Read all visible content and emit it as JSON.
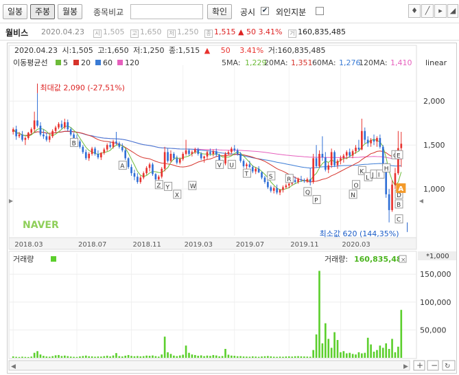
{
  "toolbar": {
    "periods": [
      "일봉",
      "주봉",
      "월봉"
    ],
    "active_period": "주봉",
    "compare_label": "종목비교",
    "compare_value": "",
    "confirm_label": "확인",
    "disclosure_label": "공시",
    "disclosure_checked": true,
    "foreign_label": "외인지분",
    "foreign_checked": false
  },
  "info": {
    "name": "월비스",
    "date": "2020.04.23",
    "open": "1,505",
    "high": "1,650",
    "low": "1,250",
    "close": "1,515",
    "change": "▲ 50",
    "pct": "3.41%",
    "volume": "160,835,485",
    "open_icon": "시",
    "high_icon": "고",
    "low_icon": "저",
    "close_icon": "종",
    "volume_icon": "거"
  },
  "legend_line": {
    "date": "2020.04.23",
    "open_label": "시:",
    "open": "1,505",
    "high_label": "고:",
    "high": "1,650",
    "low_label": "저:",
    "low": "1,250",
    "close_label": "종:",
    "close": "1,515",
    "arrow": "▲",
    "change": "50",
    "pct": "3.41%",
    "vol_label": "거:",
    "volume": "160,835,485"
  },
  "ma_legend": {
    "title": "이동평균선",
    "items": [
      {
        "label": "5",
        "color": "#6dbb3a"
      },
      {
        "label": "20",
        "color": "#d6332b"
      },
      {
        "label": "60",
        "color": "#3a7bd5"
      },
      {
        "label": "120",
        "color": "#e65fbd"
      }
    ],
    "values": [
      {
        "label": "5MA:",
        "value": "1,229",
        "color": "#6dbb3a"
      },
      {
        "label": "20MA:",
        "value": "1,351",
        "color": "#d6332b"
      },
      {
        "label": "60MA:",
        "value": "1,276",
        "color": "#3a7bd5"
      },
      {
        "label": "120MA:",
        "value": "1,410",
        "color": "#e65fbd"
      }
    ]
  },
  "scale_label": "linear",
  "max_annotation": "최대값 2,090 (-27,51%)",
  "min_annotation": "최소값 620 (144,35%)",
  "watermark": "NAVER",
  "volume_panel": {
    "title": "거래량",
    "legend_label": "거래량:",
    "legend_value": "160,835,485",
    "unit": "*1,000"
  },
  "colors": {
    "up": "#e8322e",
    "down": "#2f6fd6",
    "ma5": "#6dbb3a",
    "ma20": "#d6332b",
    "ma60": "#3a7bd5",
    "ma120": "#e65fbd",
    "volume": "#5ccf2d",
    "marker_orange": "#f39a2b"
  },
  "chart_data": [
    {
      "type": "candlestick",
      "title": "",
      "xlabel": "",
      "ylabel": "",
      "x_ticks": [
        "2018.03",
        "2018.07",
        "2018.11",
        "2019.03",
        "2019.07",
        "2019.11",
        "2020.03"
      ],
      "y_ticks": [
        1000,
        1500,
        2000
      ],
      "ylim": [
        470,
        2330
      ],
      "scale": "linear",
      "max_point": {
        "value": 2090,
        "date_index": 8
      },
      "min_point": {
        "value": 620,
        "date_index": 130
      },
      "ohlc": [
        {
          "o": 1650,
          "h": 1700,
          "l": 1620,
          "c": 1680
        },
        {
          "o": 1680,
          "h": 1720,
          "l": 1560,
          "c": 1600
        },
        {
          "o": 1600,
          "h": 1650,
          "l": 1580,
          "c": 1620
        },
        {
          "o": 1620,
          "h": 1660,
          "l": 1540,
          "c": 1560
        },
        {
          "o": 1560,
          "h": 1600,
          "l": 1500,
          "c": 1580
        },
        {
          "o": 1580,
          "h": 1650,
          "l": 1560,
          "c": 1640
        },
        {
          "o": 1640,
          "h": 1700,
          "l": 1620,
          "c": 1680
        },
        {
          "o": 1680,
          "h": 1880,
          "l": 1650,
          "c": 1780
        },
        {
          "o": 1780,
          "h": 2090,
          "l": 1700,
          "c": 1720
        },
        {
          "o": 1720,
          "h": 1760,
          "l": 1600,
          "c": 1620
        },
        {
          "o": 1620,
          "h": 1680,
          "l": 1570,
          "c": 1600
        },
        {
          "o": 1600,
          "h": 1640,
          "l": 1540,
          "c": 1560
        },
        {
          "o": 1560,
          "h": 1620,
          "l": 1530,
          "c": 1600
        },
        {
          "o": 1600,
          "h": 1680,
          "l": 1580,
          "c": 1660
        },
        {
          "o": 1660,
          "h": 1720,
          "l": 1640,
          "c": 1700
        },
        {
          "o": 1700,
          "h": 1760,
          "l": 1680,
          "c": 1740
        },
        {
          "o": 1740,
          "h": 1780,
          "l": 1680,
          "c": 1700
        },
        {
          "o": 1700,
          "h": 1800,
          "l": 1680,
          "c": 1760
        },
        {
          "o": 1760,
          "h": 1790,
          "l": 1660,
          "c": 1680
        },
        {
          "o": 1680,
          "h": 1700,
          "l": 1600,
          "c": 1620
        },
        {
          "o": 1620,
          "h": 1640,
          "l": 1560,
          "c": 1580
        },
        {
          "o": 1580,
          "h": 1620,
          "l": 1520,
          "c": 1540
        },
        {
          "o": 1540,
          "h": 1560,
          "l": 1460,
          "c": 1480
        },
        {
          "o": 1480,
          "h": 1500,
          "l": 1400,
          "c": 1420
        },
        {
          "o": 1420,
          "h": 1450,
          "l": 1330,
          "c": 1350
        },
        {
          "o": 1350,
          "h": 1420,
          "l": 1320,
          "c": 1400
        },
        {
          "o": 1400,
          "h": 1480,
          "l": 1380,
          "c": 1460
        },
        {
          "o": 1460,
          "h": 1480,
          "l": 1380,
          "c": 1400
        },
        {
          "o": 1400,
          "h": 1440,
          "l": 1340,
          "c": 1360
        },
        {
          "o": 1360,
          "h": 1420,
          "l": 1330,
          "c": 1410
        },
        {
          "o": 1410,
          "h": 1470,
          "l": 1390,
          "c": 1450
        },
        {
          "o": 1450,
          "h": 1520,
          "l": 1430,
          "c": 1500
        },
        {
          "o": 1500,
          "h": 1540,
          "l": 1460,
          "c": 1480
        },
        {
          "o": 1480,
          "h": 1560,
          "l": 1460,
          "c": 1540
        },
        {
          "o": 1540,
          "h": 1650,
          "l": 1500,
          "c": 1520
        },
        {
          "o": 1520,
          "h": 1540,
          "l": 1460,
          "c": 1480
        },
        {
          "o": 1480,
          "h": 1520,
          "l": 1420,
          "c": 1440
        },
        {
          "o": 1440,
          "h": 1460,
          "l": 1330,
          "c": 1350
        },
        {
          "o": 1350,
          "h": 1360,
          "l": 1230,
          "c": 1250
        },
        {
          "o": 1250,
          "h": 1280,
          "l": 1150,
          "c": 1180
        },
        {
          "o": 1180,
          "h": 1220,
          "l": 1100,
          "c": 1140
        },
        {
          "o": 1140,
          "h": 1180,
          "l": 1060,
          "c": 1080
        },
        {
          "o": 1080,
          "h": 1150,
          "l": 1060,
          "c": 1130
        },
        {
          "o": 1130,
          "h": 1200,
          "l": 1110,
          "c": 1180
        },
        {
          "o": 1180,
          "h": 1260,
          "l": 1160,
          "c": 1240
        },
        {
          "o": 1240,
          "h": 1300,
          "l": 1200,
          "c": 1280
        },
        {
          "o": 1280,
          "h": 1300,
          "l": 1150,
          "c": 1170
        },
        {
          "o": 1170,
          "h": 1180,
          "l": 1090,
          "c": 1110
        },
        {
          "o": 1110,
          "h": 1160,
          "l": 1080,
          "c": 1140
        },
        {
          "o": 1140,
          "h": 1250,
          "l": 1120,
          "c": 1230
        },
        {
          "o": 1230,
          "h": 1480,
          "l": 1200,
          "c": 1420
        },
        {
          "o": 1420,
          "h": 1460,
          "l": 1300,
          "c": 1320
        },
        {
          "o": 1320,
          "h": 1440,
          "l": 1300,
          "c": 1400
        },
        {
          "o": 1400,
          "h": 1420,
          "l": 1330,
          "c": 1350
        },
        {
          "o": 1350,
          "h": 1380,
          "l": 1280,
          "c": 1300
        },
        {
          "o": 1300,
          "h": 1360,
          "l": 1280,
          "c": 1340
        },
        {
          "o": 1340,
          "h": 1420,
          "l": 1320,
          "c": 1400
        },
        {
          "o": 1400,
          "h": 1560,
          "l": 1380,
          "c": 1440
        },
        {
          "o": 1440,
          "h": 1460,
          "l": 1380,
          "c": 1400
        },
        {
          "o": 1400,
          "h": 1440,
          "l": 1370,
          "c": 1420
        },
        {
          "o": 1420,
          "h": 1470,
          "l": 1400,
          "c": 1450
        },
        {
          "o": 1450,
          "h": 1470,
          "l": 1380,
          "c": 1400
        },
        {
          "o": 1400,
          "h": 1420,
          "l": 1330,
          "c": 1350
        },
        {
          "o": 1350,
          "h": 1380,
          "l": 1300,
          "c": 1370
        },
        {
          "o": 1370,
          "h": 1440,
          "l": 1340,
          "c": 1420
        },
        {
          "o": 1420,
          "h": 1460,
          "l": 1380,
          "c": 1400
        },
        {
          "o": 1400,
          "h": 1450,
          "l": 1370,
          "c": 1430
        },
        {
          "o": 1430,
          "h": 1460,
          "l": 1370,
          "c": 1390
        },
        {
          "o": 1390,
          "h": 1400,
          "l": 1300,
          "c": 1310
        },
        {
          "o": 1310,
          "h": 1330,
          "l": 1260,
          "c": 1290
        },
        {
          "o": 1290,
          "h": 1420,
          "l": 1270,
          "c": 1400
        },
        {
          "o": 1400,
          "h": 1440,
          "l": 1380,
          "c": 1420
        },
        {
          "o": 1420,
          "h": 1480,
          "l": 1400,
          "c": 1460
        },
        {
          "o": 1460,
          "h": 1500,
          "l": 1420,
          "c": 1440
        },
        {
          "o": 1440,
          "h": 1460,
          "l": 1380,
          "c": 1400
        },
        {
          "o": 1400,
          "h": 1420,
          "l": 1300,
          "c": 1320
        },
        {
          "o": 1320,
          "h": 1340,
          "l": 1240,
          "c": 1260
        },
        {
          "o": 1260,
          "h": 1300,
          "l": 1220,
          "c": 1280
        },
        {
          "o": 1280,
          "h": 1320,
          "l": 1240,
          "c": 1250
        },
        {
          "o": 1250,
          "h": 1270,
          "l": 1180,
          "c": 1200
        },
        {
          "o": 1200,
          "h": 1250,
          "l": 1170,
          "c": 1230
        },
        {
          "o": 1230,
          "h": 1260,
          "l": 1180,
          "c": 1190
        },
        {
          "o": 1190,
          "h": 1200,
          "l": 1110,
          "c": 1130
        },
        {
          "o": 1130,
          "h": 1150,
          "l": 1060,
          "c": 1080
        },
        {
          "o": 1080,
          "h": 1100,
          "l": 1000,
          "c": 1020
        },
        {
          "o": 1020,
          "h": 1040,
          "l": 960,
          "c": 980
        },
        {
          "o": 980,
          "h": 1030,
          "l": 950,
          "c": 1010
        },
        {
          "o": 1010,
          "h": 1050,
          "l": 940,
          "c": 960
        },
        {
          "o": 960,
          "h": 1000,
          "l": 930,
          "c": 990
        },
        {
          "o": 990,
          "h": 1040,
          "l": 960,
          "c": 1020
        },
        {
          "o": 1020,
          "h": 1060,
          "l": 1000,
          "c": 1040
        },
        {
          "o": 1040,
          "h": 1080,
          "l": 1010,
          "c": 1060
        },
        {
          "o": 1060,
          "h": 1120,
          "l": 1040,
          "c": 1100
        },
        {
          "o": 1100,
          "h": 1140,
          "l": 1060,
          "c": 1080
        },
        {
          "o": 1080,
          "h": 1130,
          "l": 1060,
          "c": 1110
        },
        {
          "o": 1110,
          "h": 1150,
          "l": 1080,
          "c": 1100
        },
        {
          "o": 1100,
          "h": 1120,
          "l": 1070,
          "c": 1090
        },
        {
          "o": 1090,
          "h": 1130,
          "l": 1070,
          "c": 1110
        },
        {
          "o": 1110,
          "h": 1240,
          "l": 1040,
          "c": 1080
        },
        {
          "o": 1080,
          "h": 1400,
          "l": 1060,
          "c": 1350
        },
        {
          "o": 1350,
          "h": 1500,
          "l": 1240,
          "c": 1260
        },
        {
          "o": 1260,
          "h": 1440,
          "l": 1240,
          "c": 1400
        },
        {
          "o": 1400,
          "h": 1600,
          "l": 1320,
          "c": 1360
        },
        {
          "o": 1360,
          "h": 1420,
          "l": 1200,
          "c": 1220
        },
        {
          "o": 1220,
          "h": 1300,
          "l": 1180,
          "c": 1270
        },
        {
          "o": 1270,
          "h": 1460,
          "l": 1240,
          "c": 1420
        },
        {
          "o": 1420,
          "h": 1440,
          "l": 1250,
          "c": 1270
        },
        {
          "o": 1270,
          "h": 1340,
          "l": 1230,
          "c": 1320
        },
        {
          "o": 1320,
          "h": 1380,
          "l": 1280,
          "c": 1350
        },
        {
          "o": 1350,
          "h": 1400,
          "l": 1300,
          "c": 1380
        },
        {
          "o": 1380,
          "h": 1440,
          "l": 1340,
          "c": 1420
        },
        {
          "o": 1420,
          "h": 1460,
          "l": 1360,
          "c": 1380
        },
        {
          "o": 1380,
          "h": 1450,
          "l": 1350,
          "c": 1430
        },
        {
          "o": 1430,
          "h": 1500,
          "l": 1400,
          "c": 1470
        },
        {
          "o": 1470,
          "h": 1560,
          "l": 1430,
          "c": 1450
        },
        {
          "o": 1450,
          "h": 1800,
          "l": 1440,
          "c": 1660
        },
        {
          "o": 1660,
          "h": 1700,
          "l": 1520,
          "c": 1560
        },
        {
          "o": 1560,
          "h": 1600,
          "l": 1480,
          "c": 1520
        },
        {
          "o": 1520,
          "h": 1580,
          "l": 1480,
          "c": 1560
        },
        {
          "o": 1560,
          "h": 1620,
          "l": 1500,
          "c": 1540
        },
        {
          "o": 1540,
          "h": 1600,
          "l": 1480,
          "c": 1580
        },
        {
          "o": 1580,
          "h": 1620,
          "l": 1460,
          "c": 1480
        },
        {
          "o": 1480,
          "h": 1500,
          "l": 1200,
          "c": 1260
        },
        {
          "o": 1260,
          "h": 1300,
          "l": 900,
          "c": 940
        },
        {
          "o": 940,
          "h": 1000,
          "l": 620,
          "c": 760
        },
        {
          "o": 760,
          "h": 1100,
          "l": 740,
          "c": 1050
        },
        {
          "o": 1050,
          "h": 1240,
          "l": 1000,
          "c": 1180
        },
        {
          "o": 1180,
          "h": 1660,
          "l": 1160,
          "c": 1465
        },
        {
          "o": 1465,
          "h": 1650,
          "l": 1250,
          "c": 1515
        }
      ],
      "volume": [
        2.5,
        1.8,
        1.5,
        2.0,
        1.6,
        1.4,
        2.2,
        9.0,
        12.0,
        6.0,
        3.5,
        2.4,
        2.0,
        3.0,
        4.5,
        5.0,
        3.2,
        4.0,
        3.0,
        2.2,
        1.8,
        1.6,
        2.5,
        3.2,
        4.0,
        2.8,
        2.6,
        2.0,
        2.4,
        2.2,
        3.0,
        3.8,
        2.6,
        4.2,
        8.5,
        3.0,
        2.4,
        3.8,
        5.0,
        3.4,
        2.8,
        3.2,
        2.6,
        3.0,
        4.0,
        3.6,
        4.2,
        3.0,
        2.2,
        6.0,
        38.0,
        10.0,
        7.0,
        4.0,
        3.0,
        4.2,
        5.6,
        22.0,
        9.0,
        6.0,
        5.0,
        3.6,
        4.4,
        3.0,
        4.0,
        3.4,
        5.0,
        4.2,
        2.6,
        3.2,
        16.0,
        5.6,
        4.0,
        3.6,
        2.8,
        3.0,
        2.4,
        2.2,
        2.0,
        2.6,
        2.2,
        1.8,
        2.4,
        2.8,
        3.2,
        2.6,
        2.0,
        1.8,
        2.2,
        1.9,
        2.4,
        2.6,
        2.2,
        2.8,
        3.0,
        2.6,
        2.4,
        2.2,
        2.0,
        14.0,
        42.0,
        156.0,
        26.0,
        62.0,
        34.0,
        18.0,
        46.0,
        32.0,
        10.0,
        12.0,
        8.0,
        9.0,
        7.0,
        6.0,
        10.0,
        8.0,
        9.0,
        36.0,
        24.0,
        11.0,
        14.0,
        22.0,
        18.0,
        26.0,
        16.0,
        34.0,
        10.0,
        20.0,
        86.0,
        160.8
      ]
    }
  ]
}
